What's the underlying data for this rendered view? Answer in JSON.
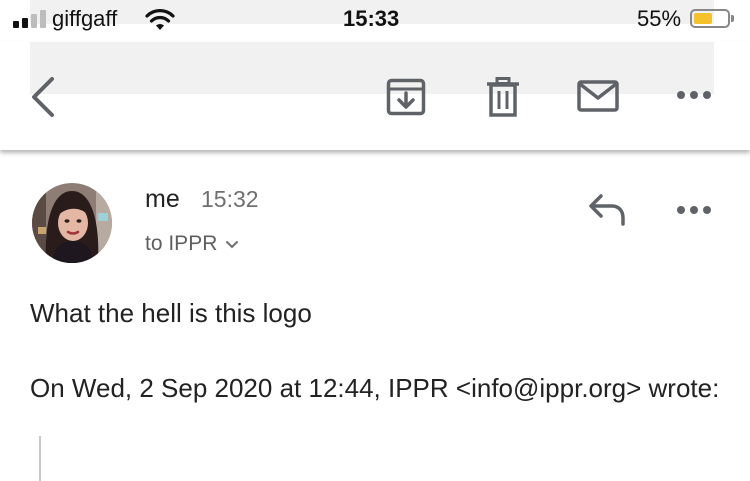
{
  "status_bar": {
    "carrier": "giffgaff",
    "time": "15:33",
    "battery_percent_label": "55%",
    "battery_level": 0.55,
    "signal_bars_active": 2,
    "signal_bars_total": 4,
    "battery_color": "#f5c22b"
  },
  "toolbar": {
    "icons": [
      "back-arrow-icon",
      "archive-icon",
      "trash-icon",
      "mail-icon",
      "more-icon"
    ]
  },
  "message": {
    "sender": "me",
    "time": "15:32",
    "recipient": "to IPPR",
    "body": "What the hell is this logo",
    "quote_header": "On Wed, 2 Sep 2020 at 12:44, IPPR <info@ippr.org> wrote:"
  },
  "colors": {
    "text": "#222222",
    "muted": "#6f6f6f",
    "icon": "#5f6368"
  }
}
